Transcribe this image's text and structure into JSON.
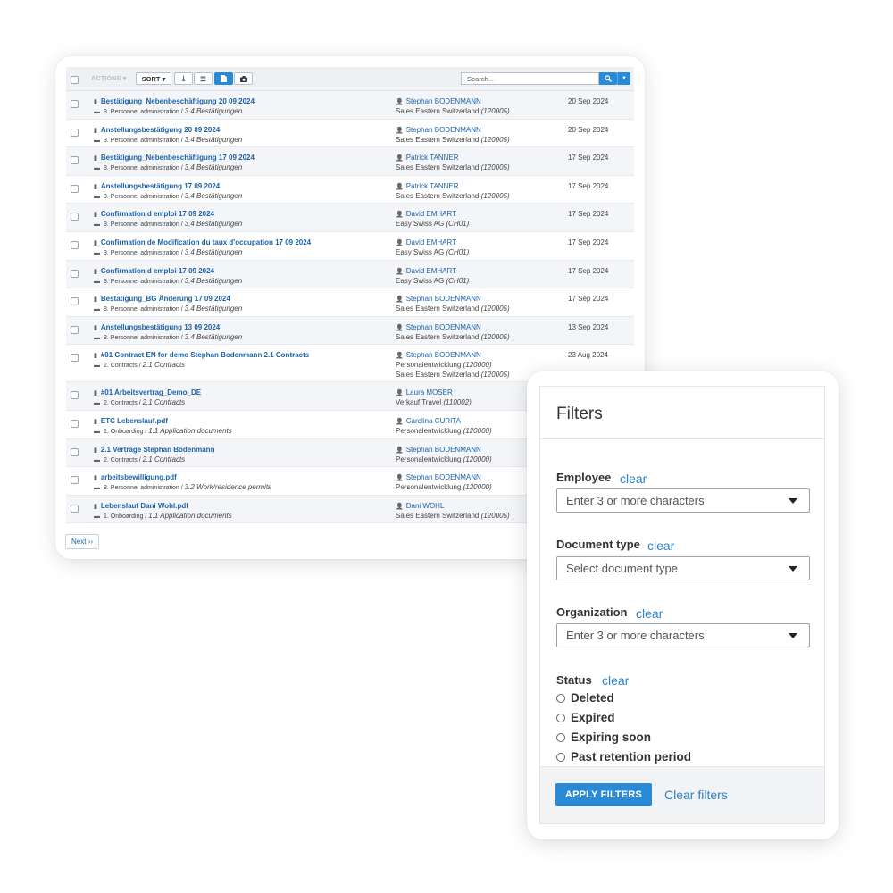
{
  "toolbar": {
    "actions_label": "ACTIONS",
    "sort_label": "SORT",
    "search_placeholder": "Search..."
  },
  "rows": [
    {
      "title": "Bestätigung_Nebenbeschäftigung 20 09 2024",
      "category": "3. Personnel administration",
      "subcategory": "3.4 Bestätigungen",
      "person": "Stephan BODENMANN",
      "unit": "Sales Eastern Switzerland",
      "unit_code": "(120005)",
      "date": "20 Sep 2024"
    },
    {
      "title": "Anstellungsbestätigung 20 09 2024",
      "category": "3. Personnel administration",
      "subcategory": "3.4 Bestätigungen",
      "person": "Stephan BODENMANN",
      "unit": "Sales Eastern Switzerland",
      "unit_code": "(120005)",
      "date": "20 Sep 2024"
    },
    {
      "title": "Bestätigung_Nebenbeschäftigung 17 09 2024",
      "category": "3. Personnel administration",
      "subcategory": "3.4 Bestätigungen",
      "person": "Patrick TANNER",
      "unit": "Sales Eastern Switzerland",
      "unit_code": "(120005)",
      "date": "17 Sep 2024"
    },
    {
      "title": "Anstellungsbestätigung 17 09 2024",
      "category": "3. Personnel administration",
      "subcategory": "3.4 Bestätigungen",
      "person": "Patrick TANNER",
      "unit": "Sales Eastern Switzerland",
      "unit_code": "(120005)",
      "date": "17 Sep 2024"
    },
    {
      "title": "Confirmation d emploi 17 09 2024",
      "category": "3. Personnel administration",
      "subcategory": "3.4 Bestätigungen",
      "person": "David EMHART",
      "unit": "Easy Swiss AG",
      "unit_code": "(CH01)",
      "date": "17 Sep 2024"
    },
    {
      "title": "Confirmation de Modification du taux d'occupation 17 09 2024",
      "category": "3. Personnel administration",
      "subcategory": "3.4 Bestätigungen",
      "person": "David EMHART",
      "unit": "Easy Swiss AG",
      "unit_code": "(CH01)",
      "date": "17 Sep 2024"
    },
    {
      "title": "Confirmation d emploi 17 09 2024",
      "category": "3. Personnel administration",
      "subcategory": "3.4 Bestätigungen",
      "person": "David EMHART",
      "unit": "Easy Swiss AG",
      "unit_code": "(CH01)",
      "date": "17 Sep 2024"
    },
    {
      "title": "Bestätigung_BG Änderung 17 09 2024",
      "category": "3. Personnel administration",
      "subcategory": "3.4 Bestätigungen",
      "person": "Stephan BODENMANN",
      "unit": "Sales Eastern Switzerland",
      "unit_code": "(120005)",
      "date": "17 Sep 2024"
    },
    {
      "title": "Anstellungsbestätigung 13 09 2024",
      "category": "3. Personnel administration",
      "subcategory": "3.4 Bestätigungen",
      "person": "Stephan BODENMANN",
      "unit": "Sales Eastern Switzerland",
      "unit_code": "(120005)",
      "date": "13 Sep 2024"
    },
    {
      "title": "#01 Contract EN for demo Stephan Bodenmann 2.1 Contracts",
      "category": "2. Contracts",
      "subcategory": "2.1 Contracts",
      "person": "Stephan BODENMANN",
      "unit": "Personalentwicklung",
      "unit_code": "(120000)",
      "unit2": "Sales Eastern Switzerland",
      "unit2_code": "(120005)",
      "date": "23 Aug 2024"
    },
    {
      "title": "#01 Arbeitsvertrag_Demo_DE",
      "category": "2. Contracts",
      "subcategory": "2.1 Contracts",
      "person": "Laura MOSER",
      "unit": "Verkauf Travel",
      "unit_code": "(110002)",
      "date": ""
    },
    {
      "title": "ETC Lebenslauf.pdf",
      "category": "1. Onboarding",
      "subcategory": "1.1 Application documents",
      "person": "Carolina CURITA",
      "unit": "Personalentwicklung",
      "unit_code": "(120000)",
      "date": ""
    },
    {
      "title": "2.1 Verträge Stephan Bodenmann",
      "category": "2. Contracts",
      "subcategory": "2.1 Contracts",
      "person": "Stephan BODENMANN",
      "unit": "Personalentwicklung",
      "unit_code": "(120000)",
      "date": ""
    },
    {
      "title": "arbeitsbewilligung.pdf",
      "category": "3. Personnel administration",
      "subcategory": "3.2 Work/residence permits",
      "person": "Stephan BODENMANN",
      "unit": "Personalentwicklung",
      "unit_code": "(120000)",
      "date": ""
    },
    {
      "title": "Lebenslauf Dani Wohl.pdf",
      "category": "1. Onboarding",
      "subcategory": "1.1 Application documents",
      "person": "Dani WOHL",
      "unit": "Sales Eastern Switzerland",
      "unit_code": "(120005)",
      "date": ""
    }
  ],
  "pagination": {
    "next_label": "Next ››"
  },
  "filters": {
    "title": "Filters",
    "employee_label": "Employee",
    "employee_placeholder": "Enter 3 or more characters",
    "doctype_label": "Document type",
    "doctype_placeholder": "Select document type",
    "org_label": "Organization",
    "org_placeholder": "Enter 3 or more characters",
    "status_label": "Status",
    "clear_label": "clear",
    "status_options": [
      "Deleted",
      "Expired",
      "Expiring soon",
      "Past retention period"
    ],
    "apply_label": "APPLY FILTERS",
    "clear_filters_label": "Clear filters"
  },
  "colors": {
    "accent": "#2a8ad6",
    "link": "#1a62a8"
  }
}
